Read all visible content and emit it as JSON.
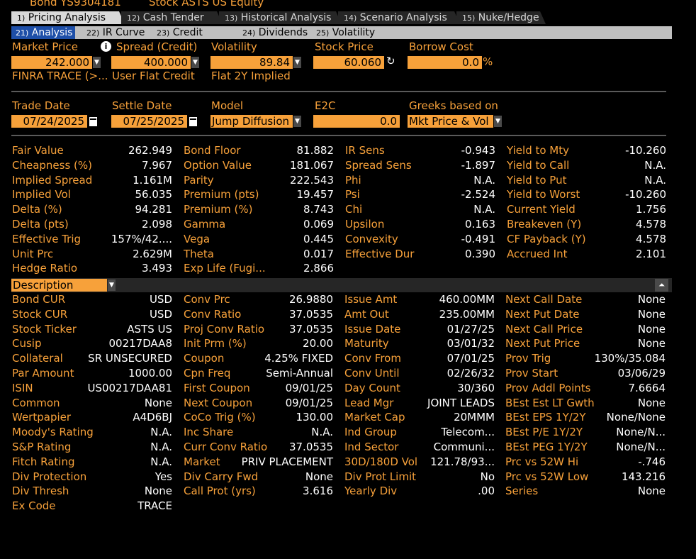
{
  "header": {
    "bond": "Bond  YS9304181",
    "stock": "Stock ASTS US Equity"
  },
  "tabs": [
    {
      "num": "1)",
      "label": "Pricing Analysis"
    },
    {
      "num": "12)",
      "label": "Cash Tender"
    },
    {
      "num": "13)",
      "label": "Historical Analysis"
    },
    {
      "num": "14)",
      "label": "Scenario Analysis"
    },
    {
      "num": "15)",
      "label": "Nuke/Hedge"
    }
  ],
  "subtabs": [
    {
      "num": "21)",
      "label": "Analysis"
    },
    {
      "num": "22)",
      "label": "IR Curve"
    },
    {
      "num": "23)",
      "label": "Credit Curve"
    },
    {
      "num": "24)",
      "label": "Dividends"
    },
    {
      "num": "25)",
      "label": "Volatility"
    }
  ],
  "inputs1": {
    "market_price_label": "Market Price",
    "market_price": "242.000",
    "market_price_src": "FINRA TRACE (>...",
    "spread_label": "Spread (Credit)",
    "spread": "400.000",
    "spread_src": "User Flat Credit",
    "vol_label": "Volatility",
    "vol": "89.84",
    "vol_src": "Flat 2Y Implied",
    "stock_label": "Stock Price",
    "stock": "60.060",
    "borrow_label": "Borrow Cost",
    "borrow": "0.0",
    "borrow_unit": "%"
  },
  "inputs2": {
    "trade_label": "Trade Date",
    "trade": "07/24/2025",
    "settle_label": "Settle Date",
    "settle": "07/25/2025",
    "model_label": "Model",
    "model": "Jump Diffusion",
    "e2c_label": "E2C",
    "e2c": "0.0",
    "greeks_label": "Greeks based on",
    "greeks": "Mkt Price & Vol"
  },
  "metrics": {
    "c1": [
      [
        "Fair Value",
        "262.949"
      ],
      [
        "Cheapness (%)",
        "7.967"
      ],
      [
        "Implied Spread",
        "1.161M"
      ],
      [
        "Implied Vol",
        "56.035"
      ],
      [
        "Delta (%)",
        "94.281"
      ],
      [
        "Delta (pts)",
        "2.098"
      ],
      [
        "Effective Trig",
        "157%/42...."
      ],
      [
        "Unit Prc",
        "2.629M"
      ],
      [
        "Hedge Ratio",
        "3.493"
      ]
    ],
    "c2": [
      [
        "Bond Floor",
        "81.882"
      ],
      [
        "Option Value",
        "181.067"
      ],
      [
        "Parity",
        "222.543"
      ],
      [
        "Premium (pts)",
        "19.457"
      ],
      [
        "Premium (%)",
        "8.743"
      ],
      [
        "Gamma",
        "0.069"
      ],
      [
        "Vega",
        "0.445"
      ],
      [
        "Theta",
        "0.017"
      ],
      [
        "Exp Life (Fugi...",
        "2.866"
      ]
    ],
    "c3": [
      [
        "IR Sens",
        "-0.943"
      ],
      [
        "Spread Sens",
        "-1.897"
      ],
      [
        "Phi",
        "N.A."
      ],
      [
        "Psi",
        "-2.524"
      ],
      [
        "Chi",
        "N.A."
      ],
      [
        "Upsilon",
        "0.163"
      ],
      [
        "Convexity",
        "-0.491"
      ],
      [
        "Effective Dur",
        "0.390"
      ]
    ],
    "c4": [
      [
        "Yield to Mty",
        "-10.260"
      ],
      [
        "Yield to Call",
        "N.A."
      ],
      [
        "Yield to Put",
        "N.A."
      ],
      [
        "Yield to Worst",
        "-10.260"
      ],
      [
        "Current Yield",
        "1.756"
      ],
      [
        "Breakeven (Y)",
        "4.578"
      ],
      [
        "CF Payback (Y)",
        "4.578"
      ],
      [
        "Accrued Int",
        "2.101"
      ]
    ]
  },
  "description_label": "Description",
  "desc": {
    "c1": [
      [
        "Bond CUR",
        "USD"
      ],
      [
        "Stock CUR",
        "USD"
      ],
      [
        "Stock Ticker",
        "ASTS US"
      ],
      [
        "Cusip",
        "00217DAA8"
      ],
      [
        "Collateral",
        "SR UNSECURED"
      ],
      [
        "Par Amount",
        "1000.00"
      ],
      [
        "ISIN",
        "US00217DAA81"
      ],
      [
        "Common",
        "None"
      ],
      [
        "Wertpapier",
        "A4D6BJ"
      ],
      [
        "Moody's Rating",
        "N.A."
      ],
      [
        "S&P Rating",
        "N.A."
      ],
      [
        "Fitch Rating",
        "N.A."
      ],
      [
        "Div Protection",
        "Yes"
      ],
      [
        "Div Thresh",
        "None"
      ],
      [
        "Ex Code",
        "TRACE"
      ]
    ],
    "c2": [
      [
        "Conv Prc",
        "26.9880"
      ],
      [
        "Conv Ratio",
        "37.0535"
      ],
      [
        "Proj Conv Ratio",
        "37.0535"
      ],
      [
        "Init Prm (%)",
        "20.00"
      ],
      [
        "Coupon",
        "4.25% FIXED"
      ],
      [
        "Cpn Freq",
        "Semi-Annual"
      ],
      [
        "First Coupon",
        "09/01/25"
      ],
      [
        "Next Coupon",
        "09/01/25"
      ],
      [
        "CoCo Trig (%)",
        "130.00"
      ],
      [
        "Inc Share",
        "N.A."
      ],
      [
        "Curr Conv Ratio",
        "37.0535"
      ],
      [
        "Market",
        "PRIV PLACEMENT"
      ],
      [
        "Div Carry Fwd",
        "None"
      ],
      [
        "Call Prot (yrs)",
        "3.616"
      ]
    ],
    "c3": [
      [
        "Issue Amt",
        "460.00MM"
      ],
      [
        "Amt Out",
        "235.00MM"
      ],
      [
        "Issue Date",
        "01/27/25"
      ],
      [
        "Maturity",
        "03/01/32"
      ],
      [
        "Conv From",
        "07/01/25"
      ],
      [
        "Conv Until",
        "02/26/32"
      ],
      [
        "Day Count",
        "30/360"
      ],
      [
        "Lead Mgr",
        "JOINT LEADS"
      ],
      [
        "Market Cap",
        "20MMM"
      ],
      [
        "Ind Group",
        "Telecom..."
      ],
      [
        "Ind Sector",
        "Communi..."
      ],
      [
        "30D/180D Vol",
        "121.78/93..."
      ],
      [
        "Div Prot Limit",
        "No"
      ],
      [
        "Yearly Div",
        ".00"
      ]
    ],
    "c4": [
      [
        "Next Call Date",
        "None"
      ],
      [
        "Next Put Date",
        "None"
      ],
      [
        "Next Call Price",
        "None"
      ],
      [
        "Next Put Price",
        "None"
      ],
      [
        "Prov Trig",
        "130%/35.084"
      ],
      [
        "Prov Start",
        "03/06/29"
      ],
      [
        "Prov Addl Points",
        "7.6664"
      ],
      [
        "BEst Est LT Gwth",
        "None"
      ],
      [
        "BEst EPS 1Y/2Y",
        "None/None"
      ],
      [
        "BEst P/E 1Y/2Y",
        "None/N..."
      ],
      [
        "BEst PEG 1Y/2Y",
        "None/N..."
      ],
      [
        "Prc vs 52W Hi",
        "-.746"
      ],
      [
        "Prc vs 52W Low",
        "143.216"
      ],
      [
        "Series",
        "None"
      ]
    ]
  }
}
